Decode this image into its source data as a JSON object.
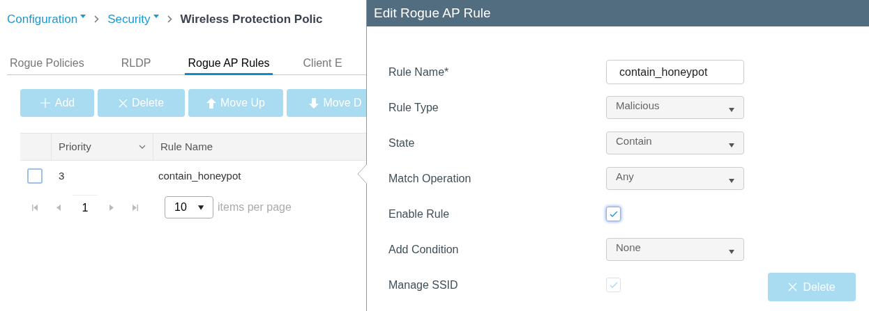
{
  "breadcrumb": [
    {
      "label": "Configuration",
      "dropdown": true,
      "current": false
    },
    {
      "label": "Security",
      "dropdown": true,
      "current": false
    },
    {
      "label": "Wireless Protection Polic",
      "dropdown": false,
      "current": true
    }
  ],
  "tabs": [
    {
      "label": "Rogue Policies",
      "selected": false
    },
    {
      "label": "RLDP",
      "selected": false
    },
    {
      "label": "Rogue AP Rules",
      "selected": true
    },
    {
      "label": "Client E",
      "selected": false
    }
  ],
  "toolbar": [
    {
      "label": "Add",
      "kind": "plus",
      "disabled": true
    },
    {
      "label": "Delete",
      "kind": "cross",
      "disabled": true
    },
    {
      "label": "Move Up",
      "kind": "up",
      "disabled": true
    },
    {
      "label": "Move D",
      "kind": "down",
      "disabled": true
    }
  ],
  "table": {
    "columns": [
      "Priority",
      "Rule Name"
    ],
    "rows": [
      {
        "checked": false,
        "cells": [
          "3",
          "contain_honeypot"
        ]
      }
    ]
  },
  "pager": {
    "page": "1",
    "page_size": "10",
    "suffix": "items per page"
  },
  "panel": {
    "title": "Edit Rogue AP Rule",
    "fields": [
      {
        "label": "Rule Name*",
        "kind": "text",
        "value": "contain_honeypot"
      },
      {
        "label": "Rule Type",
        "kind": "select",
        "value": "Malicious"
      },
      {
        "label": "State",
        "kind": "select",
        "value": "Contain"
      },
      {
        "label": "Match Operation",
        "kind": "select",
        "value": "Any"
      },
      {
        "label": "Enable Rule",
        "kind": "checkbox",
        "checked": true,
        "disabled": false
      },
      {
        "label": "Add Condition",
        "kind": "select",
        "value": "None"
      },
      {
        "label": "Manage SSID",
        "kind": "checkbox",
        "checked": true,
        "disabled": true
      }
    ],
    "delete_button": {
      "label": "Delete",
      "disabled": true
    }
  }
}
